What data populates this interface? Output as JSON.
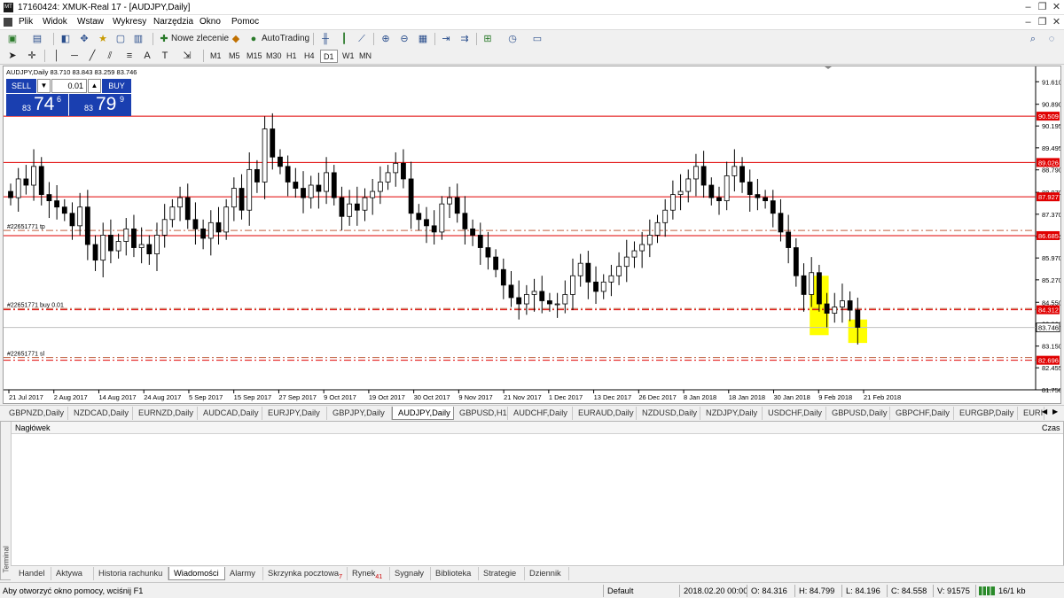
{
  "window": {
    "title": "17160424: XMUK-Real 17 - [AUDJPY,Daily]",
    "app_icon": "mt4-logo-icon"
  },
  "menu": [
    "Plik",
    "Widok",
    "Wstaw",
    "Wykresy",
    "Narzędzia",
    "Okno",
    "Pomoc"
  ],
  "toolbar": {
    "new_order": "Nowe zlecenie",
    "autotrading": "AutoTrading"
  },
  "timeframes": [
    "M1",
    "M5",
    "M15",
    "M30",
    "H1",
    "H4",
    "D1",
    "W1",
    "MN"
  ],
  "chart": {
    "header": "AUDJPY,Daily  83.710 83.843 83.259 83.746",
    "sell_label": "SELL",
    "buy_label": "BUY",
    "lot": "0.01",
    "sell_small": "83",
    "sell_big": "74",
    "sell_sup": "6",
    "buy_small": "83",
    "buy_big": "79",
    "buy_sup": "9",
    "order_labels": {
      "tp": "#22651771 tp",
      "buy": "#22651771 buy 0.01",
      "sl": "#22651771 sl"
    }
  },
  "chart_data": {
    "type": "candlestick",
    "symbol": "AUDJPY",
    "timeframe": "Daily",
    "ylim": [
      81.75,
      92.1
    ],
    "price_ticks": [
      "91.610",
      "90.890",
      "90.195",
      "89.495",
      "88.790",
      "88.070",
      "87.370",
      "86.655",
      "85.970",
      "85.270",
      "84.550",
      "83.860",
      "83.150",
      "82.455",
      "81.750"
    ],
    "date_ticks": [
      "21 Jul 2017",
      "2 Aug 2017",
      "14 Aug 2017",
      "24 Aug 2017",
      "5 Sep 2017",
      "15 Sep 2017",
      "27 Sep 2017",
      "9 Oct 2017",
      "19 Oct 2017",
      "30 Oct 2017",
      "9 Nov 2017",
      "21 Nov 2017",
      "1 Dec 2017",
      "13 Dec 2017",
      "26 Dec 2017",
      "8 Jan 2018",
      "18 Jan 2018",
      "30 Jan 2018",
      "9 Feb 2018",
      "21 Feb 2018"
    ],
    "levels": [
      {
        "label": "90.509",
        "value": 90.509,
        "style": "solid",
        "color": "#e00000"
      },
      {
        "label": "89.026",
        "value": 89.026,
        "style": "solid",
        "color": "#e00000"
      },
      {
        "label": "87.927",
        "value": 87.927,
        "style": "solid",
        "color": "#e00000"
      },
      {
        "label": "86.685",
        "value": 86.685,
        "style": "solid",
        "color": "#e00000"
      },
      {
        "label": "84.312",
        "value": 84.312,
        "style": "dashdot",
        "color": "#e00000"
      },
      {
        "label": "82.696",
        "value": 82.696,
        "style": "dashdot",
        "color": "#e00000"
      }
    ],
    "dashdot_lines": [
      {
        "value": 86.85,
        "kind": "tp"
      },
      {
        "value": 84.35,
        "kind": "buy"
      },
      {
        "value": 82.78,
        "kind": "sl"
      }
    ],
    "current_price": {
      "label": "83.746",
      "value": 83.746
    },
    "closes": [
      87.9,
      88.5,
      88.3,
      88.9,
      88.0,
      87.8,
      87.6,
      87.4,
      87.0,
      87.6,
      86.4,
      85.9,
      86.7,
      86.2,
      86.5,
      86.9,
      86.3,
      86.4,
      86.1,
      86.7,
      87.2,
      87.6,
      87.9,
      87.2,
      86.9,
      86.6,
      87.1,
      86.8,
      87.6,
      88.2,
      87.5,
      88.8,
      88.4,
      90.1,
      89.2,
      88.9,
      88.4,
      88.2,
      87.9,
      88.3,
      88.1,
      88.7,
      87.9,
      87.3,
      87.7,
      87.5,
      87.9,
      88.1,
      88.4,
      88.7,
      89.0,
      88.5,
      87.4,
      87.2,
      87.0,
      86.8,
      87.7,
      87.9,
      87.4,
      86.9,
      86.7,
      86.3,
      86.0,
      85.6,
      85.1,
      84.7,
      84.5,
      84.8,
      84.9,
      84.6,
      84.5,
      84.5,
      84.8,
      85.4,
      85.8,
      85.2,
      84.9,
      85.2,
      85.4,
      85.7,
      86.0,
      86.2,
      86.4,
      86.7,
      87.1,
      87.5,
      88.0,
      88.1,
      88.5,
      88.9,
      88.3,
      87.9,
      87.8,
      88.6,
      88.9,
      88.4,
      88.0,
      87.9,
      87.8,
      87.4,
      86.8,
      86.3,
      85.4,
      84.8,
      85.5,
      84.5,
      84.2,
      84.4,
      84.6,
      84.3,
      83.75
    ],
    "highlights": [
      {
        "from_index": 104,
        "to_index": 105,
        "y_top": 85.4,
        "y_bottom": 83.5,
        "color": "#ffff00"
      },
      {
        "from_index": 109,
        "to_index": 110,
        "y_top": 84.0,
        "y_bottom": 83.25,
        "color": "#ffff00"
      }
    ]
  },
  "symbol_tabs": [
    "GBPNZD,Daily",
    "NZDCAD,Daily",
    "EURNZD,Daily",
    "AUDCAD,Daily",
    "EURJPY,Daily",
    "GBPJPY,Daily",
    "AUDJPY,Daily",
    "GBPUSD,H1",
    "AUDCHF,Daily",
    "EURAUD,Daily",
    "NZDUSD,Daily",
    "NZDJPY,Daily",
    "USDCHF,Daily",
    "GBPUSD,Daily",
    "GBPCHF,Daily",
    "EURGBP,Daily",
    "EURI"
  ],
  "active_symbol_tab": "AUDJPY,Daily",
  "terminal": {
    "side_label": "Terminal",
    "col_header": "Nagłówek",
    "col_time": "Czas"
  },
  "bottom_tabs": [
    {
      "label": "Handel",
      "badge": ""
    },
    {
      "label": "Aktywa",
      "badge": ""
    },
    {
      "label": "Historia rachunku",
      "badge": ""
    },
    {
      "label": "Wiadomości",
      "badge": ""
    },
    {
      "label": "Alarmy",
      "badge": ""
    },
    {
      "label": "Skrzynka pocztowa",
      "badge": "7"
    },
    {
      "label": "Rynek",
      "badge": "41"
    },
    {
      "label": "Sygnały",
      "badge": ""
    },
    {
      "label": "Biblioteka",
      "badge": ""
    },
    {
      "label": "Strategie",
      "badge": ""
    },
    {
      "label": "Dziennik",
      "badge": ""
    }
  ],
  "active_bottom_tab": "Wiadomości",
  "status": {
    "help": "Aby otworzyć okno pomocy, wciśnij F1",
    "profile": "Default",
    "datetime": "2018.02.20 00:00",
    "open": "O: 84.316",
    "high": "H: 84.799",
    "low": "L: 84.196",
    "close": "C: 84.558",
    "volume": "V: 91575",
    "traffic": "16/1 kb"
  }
}
